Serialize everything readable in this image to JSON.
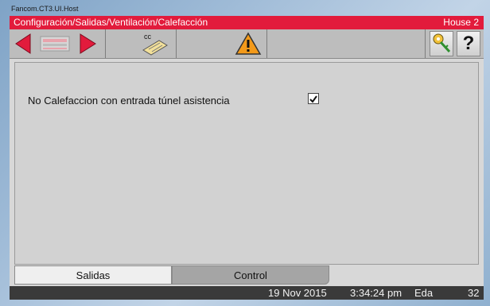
{
  "window": {
    "title": "Fancom.CT3.UI.Host"
  },
  "header": {
    "path": "Configuración/Salidas/Ventilación/Calefacción",
    "house": "House 2"
  },
  "toolbar": {
    "icons": {
      "back": "arrow-left-icon",
      "keyboard": "keyboard-icon",
      "forward": "arrow-right-icon",
      "cc": "cc-ticket-icon",
      "alarm": "warning-icon",
      "key": "key-icon",
      "help": "help-icon"
    },
    "cc_label": "cc",
    "help_label": "?"
  },
  "content": {
    "option_label": "No Calefaccion con entrada túnel asistencia",
    "option_checked": true
  },
  "tabs": [
    {
      "label": "Salidas",
      "active": true
    },
    {
      "label": "Control",
      "active": false
    }
  ],
  "status": {
    "date": "19 Nov 2015",
    "time": "3:34:24 pm",
    "mode": "Eda",
    "number": "32"
  },
  "colors": {
    "header": "#e21b3c",
    "arrows": "#e21b3c",
    "warning": "#f39a1a"
  }
}
